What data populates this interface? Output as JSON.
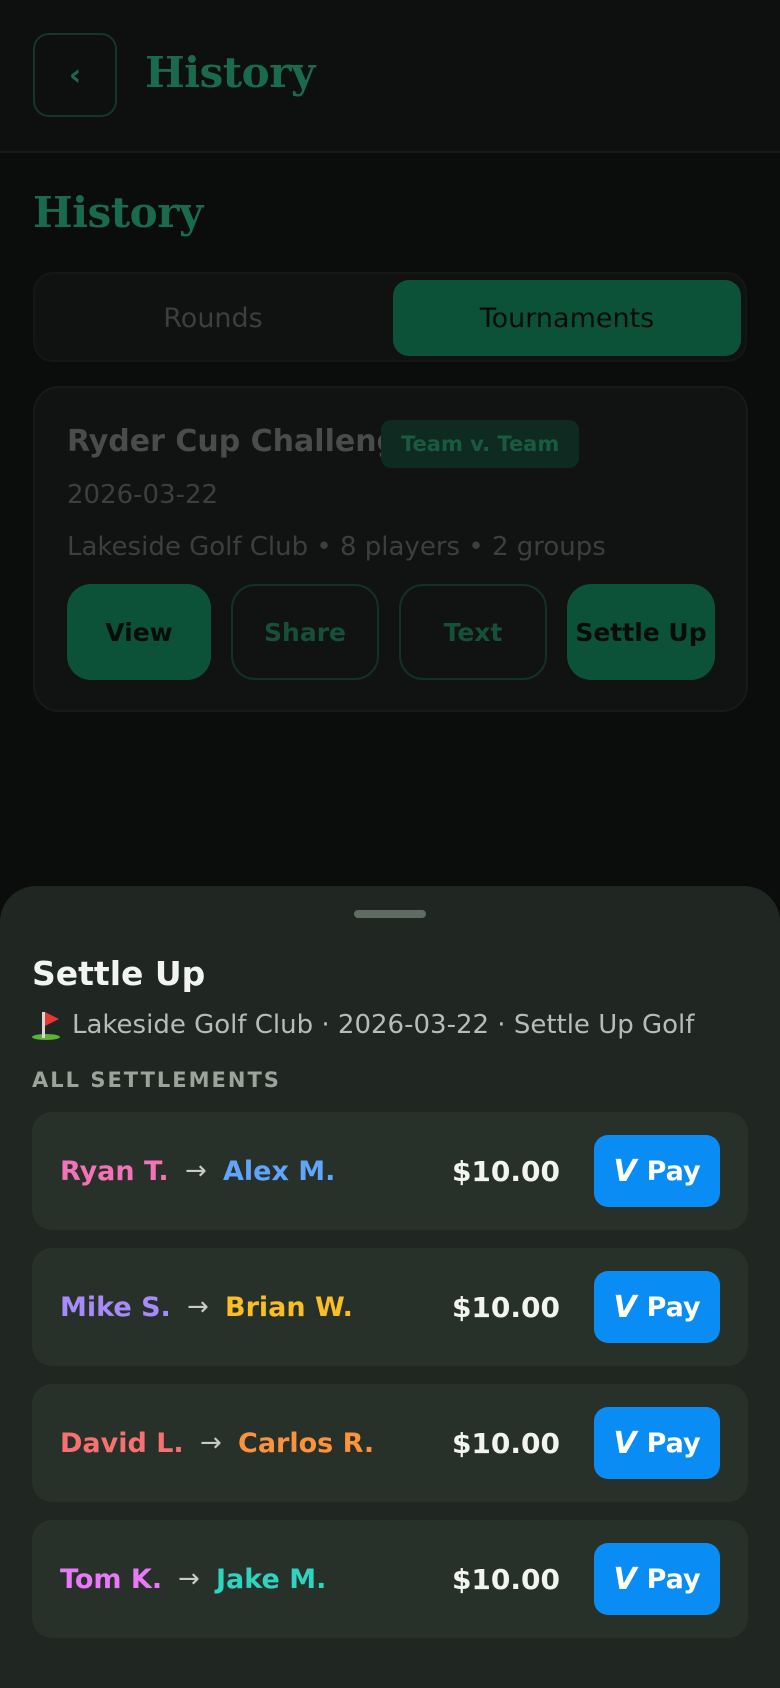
{
  "header": {
    "title": "History",
    "back_icon": "chevron-left-icon"
  },
  "page": {
    "title": "History"
  },
  "tabs": [
    {
      "label": "Rounds",
      "active": false
    },
    {
      "label": "Tournaments",
      "active": true
    }
  ],
  "tournament_card": {
    "title": "Ryder Cup Challenge",
    "badge": "Team v. Team",
    "date": "2026-03-22",
    "meta": "Lakeside Golf Club • 8 players • 2 groups",
    "buttons": {
      "view": "View",
      "share": "Share",
      "text": "Text",
      "settle": "Settle Up"
    }
  },
  "sheet": {
    "title": "Settle Up",
    "subtitle": "Lakeside Golf Club · 2026-03-22 · Settle Up Golf",
    "section_label": "ALL SETTLEMENTS",
    "settlements": [
      {
        "from": "Ryan T.",
        "from_color": "#f472b6",
        "to": "Alex M.",
        "to_color": "#60a5fa",
        "amount": "$10.00",
        "pay_label": "Pay"
      },
      {
        "from": "Mike S.",
        "from_color": "#a78bfa",
        "to": "Brian W.",
        "to_color": "#fbbf24",
        "amount": "$10.00",
        "pay_label": "Pay"
      },
      {
        "from": "David L.",
        "from_color": "#f87171",
        "to": "Carlos R.",
        "to_color": "#fb923c",
        "amount": "$10.00",
        "pay_label": "Pay"
      },
      {
        "from": "Tom K.",
        "from_color": "#e879f9",
        "to": "Jake M.",
        "to_color": "#2dd4bf",
        "amount": "$10.00",
        "pay_label": "Pay"
      }
    ]
  },
  "colors": {
    "accent": "#0c5238",
    "pay_blue": "#0a8cf5",
    "sheet_bg": "#202621"
  }
}
